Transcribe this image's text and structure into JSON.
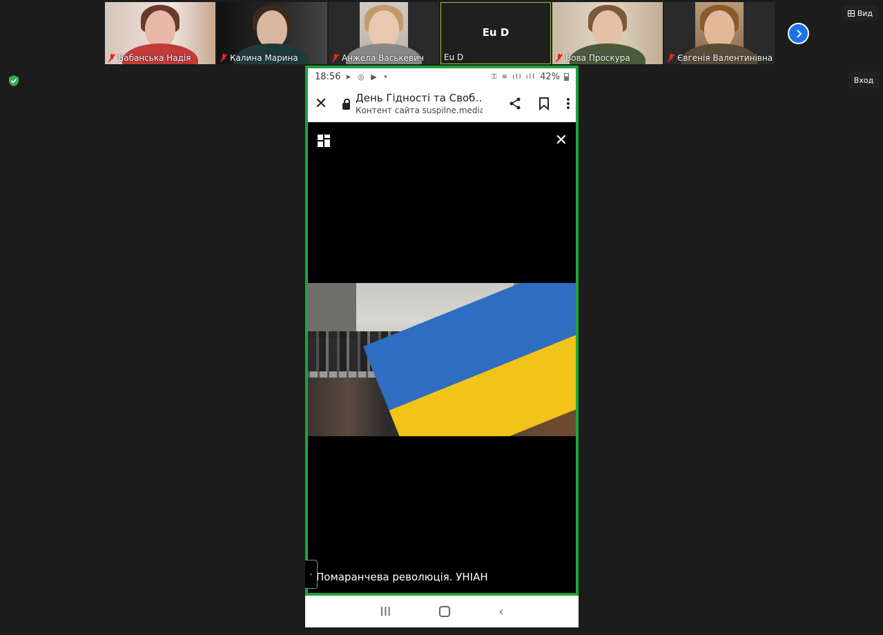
{
  "participants": [
    {
      "name": "Бабанська Надія",
      "muted": true
    },
    {
      "name": "Калина Марина",
      "muted": true
    },
    {
      "name": "Анжела Васькевич",
      "muted": true
    },
    {
      "name": "Eu D",
      "label": "Eu D",
      "muted": false,
      "active": true
    },
    {
      "name": "Вова Проскура",
      "muted": true
    },
    {
      "name": "Євгенія Валентинівна",
      "muted": true
    }
  ],
  "meeting": {
    "view_label": "Вид",
    "enter_label": "Вход"
  },
  "phone": {
    "status": {
      "time": "18:56",
      "battery": "42%"
    },
    "toolbar": {
      "title": "День Гідності та Своб…",
      "subtitle": "Контент сайта suspilne.media. П"
    },
    "caption": "Помаранчева революція. УНІАН",
    "nav": {
      "recent": "III",
      "back": "‹"
    }
  },
  "colors": {
    "share_border": "#1fa33a",
    "active_border": "#a7c53a",
    "next_button": "#1a73e8",
    "muted_icon": "#e02828"
  }
}
